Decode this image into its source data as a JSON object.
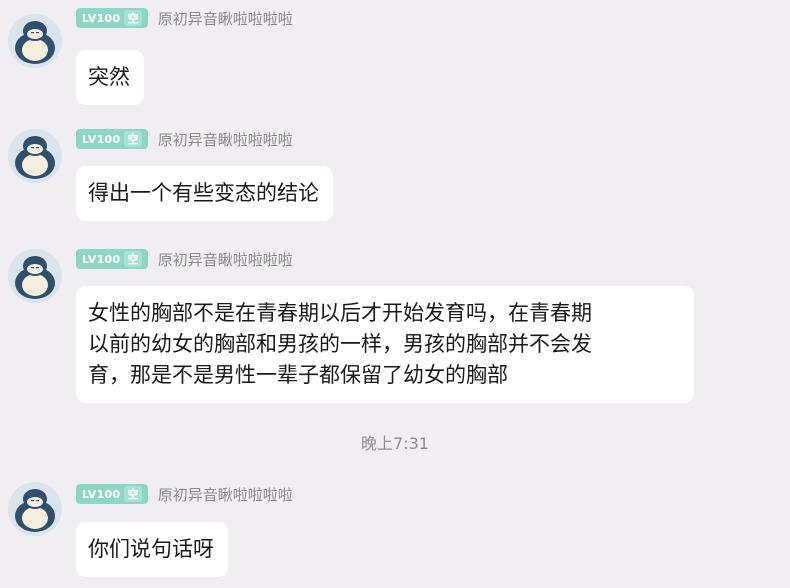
{
  "messages": [
    {
      "badge_level": "LV100",
      "badge_tag": "空",
      "nickname": "原初异音瞅啦啦啦啦",
      "lines": [
        "突然"
      ]
    },
    {
      "badge_level": "LV100",
      "badge_tag": "空",
      "nickname": "原初异音瞅啦啦啦啦",
      "lines": [
        "得出一个有些变态的结论"
      ]
    },
    {
      "badge_level": "LV100",
      "badge_tag": "空",
      "nickname": "原初异音瞅啦啦啦啦",
      "lines": [
        "女性的胸部不是在青春期以后才开始发育吗，在青春期",
        "以前的幼女的胸部和男孩的一样，男孩的胸部并不会发",
        "育，那是不是男性一辈子都保留了幼女的胸部"
      ]
    },
    {
      "badge_level": "LV100",
      "badge_tag": "空",
      "nickname": "原初异音瞅啦啦啦啦",
      "lines": [
        "你们说句话呀"
      ]
    }
  ],
  "timestamp": "晚上7:31",
  "colors": {
    "background": "#f1eef2",
    "bubble": "#ffffff",
    "badge": "#8dd6c6",
    "avatar_bg": "#dbe4ea",
    "avatar_body": "#2f4f6b"
  },
  "icons": {
    "avatar": "snorlax-avatar-icon"
  }
}
